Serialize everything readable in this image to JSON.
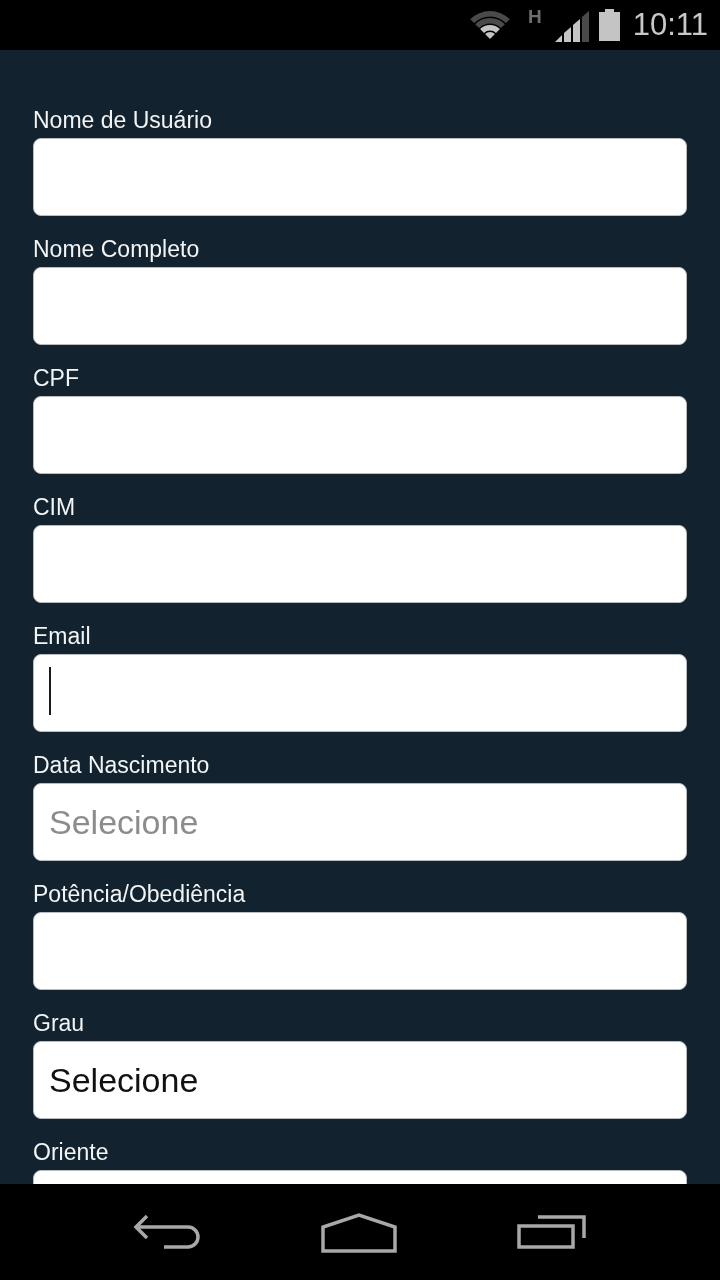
{
  "status_bar": {
    "network_type": "H",
    "time": "10:11"
  },
  "form": {
    "fields": [
      {
        "label": "Nome de Usuário",
        "focused": false
      },
      {
        "label": "Nome Completo",
        "focused": false
      },
      {
        "label": "CPF",
        "focused": false
      },
      {
        "label": "CIM",
        "focused": false
      },
      {
        "label": "Email",
        "focused": true
      },
      {
        "label": "Data Nascimento",
        "placeholder": "Selecione",
        "focused": false
      },
      {
        "label": "Potência/Obediência",
        "focused": false
      },
      {
        "label": "Grau",
        "value": "Selecione",
        "focused": false
      },
      {
        "label": "Oriente",
        "focused": false
      }
    ]
  }
}
